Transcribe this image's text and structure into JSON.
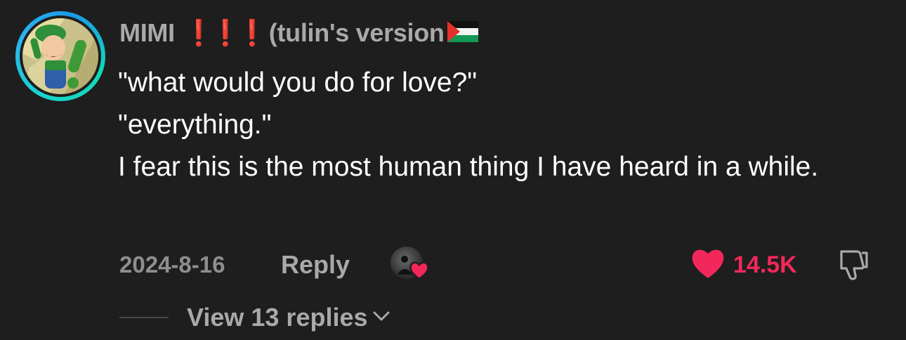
{
  "comment": {
    "author": {
      "name": "MIMI",
      "emphasis_marks": [
        "❗",
        "❗",
        "❗"
      ],
      "name_suffix": "(tulin's version",
      "flag_icon": "palestine-flag-icon",
      "avatar_icon": "cartoon-character-avatar"
    },
    "lines": [
      "\"what would you do for love?\"",
      "\"everything.\"",
      "I fear this is the most human thing I have heard in a while."
    ],
    "date": "2024-8-16",
    "reply_label": "Reply",
    "creator_liked_icon": "creator-heart-badge",
    "likes": "14.5K",
    "like_icon": "heart-icon",
    "dislike_icon": "thumbs-down-icon",
    "view_replies_label": "View 13 replies",
    "expand_icon": "chevron-down-icon"
  },
  "colors": {
    "background": "#1e1e1e",
    "username": "#a9a9a9",
    "text": "#ffffff",
    "meta": "#8e8e8e",
    "like_red": "#f2285a",
    "avatar_ring": "#18d6c9"
  }
}
